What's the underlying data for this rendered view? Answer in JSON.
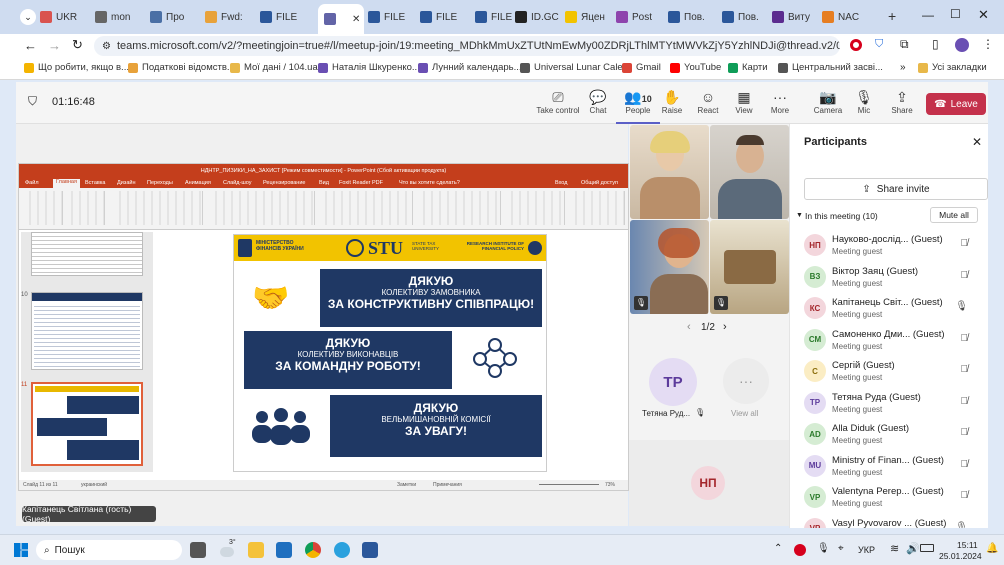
{
  "browser": {
    "tabs": [
      "UKR",
      "mon",
      "Про",
      "Fwd:",
      "FILE",
      "",
      "FILE",
      "FILE",
      "FILE",
      "ID.GC",
      "Яцен",
      "Post",
      "Пов.",
      "Пов.",
      "Виту",
      "NAC"
    ],
    "url": "teams.microsoft.com/v2/?meetingjoin=true#/l/meetup-join/19:meeting_MDhkMmUxZTUtNmEwMy00ZDRjLThlMTYtMWVkZjY5YzhlNDJi@thread.v2/0?context=...",
    "bookmarks": [
      "Що робити, якщо в...",
      "Податкові відомств...",
      "Мої дані / 104.ua",
      "Наталія Шкуренко...",
      "Лунний календарь...",
      "Universal Lunar Cale...",
      "Gmail",
      "YouTube",
      "Карти",
      "Центральний засві..."
    ],
    "all_bookmarks": "Усі закладки"
  },
  "teams": {
    "timer": "01:16:48",
    "toolbar": [
      {
        "label": "Take control",
        "icon": "take-control-icon"
      },
      {
        "label": "Chat",
        "icon": "chat-icon"
      },
      {
        "label": "People",
        "icon": "people-icon",
        "count": "10"
      },
      {
        "label": "Raise",
        "icon": "raise-hand-icon"
      },
      {
        "label": "React",
        "icon": "react-icon"
      },
      {
        "label": "View",
        "icon": "view-icon"
      },
      {
        "label": "More",
        "icon": "more-icon"
      },
      {
        "label": "Camera",
        "icon": "camera-icon"
      },
      {
        "label": "Mic",
        "icon": "mic-icon"
      },
      {
        "label": "Share",
        "icon": "share-icon"
      }
    ],
    "leave": "Leave",
    "pager": "1/2",
    "tiles": [
      {
        "initials": "ТР",
        "name": "Тетяна Руд..."
      },
      {
        "initials": "",
        "name": "View all"
      }
    ],
    "self_tile": "НП",
    "caption": "Капітанець Світлана (гость) (Guest)",
    "participants": {
      "title": "Participants",
      "share_invite": "Share invite",
      "in_meeting": "In this meeting (10)",
      "mute_all": "Mute all",
      "list": [
        {
          "initials": "НП",
          "name": "Науково-дослід... (Guest)",
          "role": "Meeting guest",
          "color": "#f3d6dc",
          "fg": "#a4262c",
          "muted": true
        },
        {
          "initials": "ВЗ",
          "name": "Віктор Заяц (Guest)",
          "role": "Meeting guest",
          "color": "#d5ecd3",
          "fg": "#2b7a2b",
          "muted": true
        },
        {
          "initials": "КС",
          "name": "Капітанець Світ... (Guest)",
          "role": "Meeting guest",
          "color": "#f3d6dc",
          "fg": "#a4262c",
          "muted": false
        },
        {
          "initials": "СМ",
          "name": "Самоненко Дми... (Guest)",
          "role": "Meeting guest",
          "color": "#d5ecd3",
          "fg": "#2b7a2b",
          "muted": true
        },
        {
          "initials": "С",
          "name": "Сергій (Guest)",
          "role": "Meeting guest",
          "color": "#fbedc4",
          "fg": "#8a6d0b",
          "muted": true
        },
        {
          "initials": "ТР",
          "name": "Тетяна Руда (Guest)",
          "role": "Meeting guest",
          "color": "#e4dcf3",
          "fg": "#5c3b9b",
          "muted": true
        },
        {
          "initials": "AD",
          "name": "Alla Diduk (Guest)",
          "role": "Meeting guest",
          "color": "#d5ecd3",
          "fg": "#2b7a2b",
          "muted": true
        },
        {
          "initials": "MU",
          "name": "Ministry of Finan... (Guest)",
          "role": "Meeting guest",
          "color": "#e4dcf3",
          "fg": "#5c3b9b",
          "muted": true
        },
        {
          "initials": "VP",
          "name": "Valentyna Perep... (Guest)",
          "role": "Meeting guest",
          "color": "#d5ecd3",
          "fg": "#2b7a2b",
          "muted": true
        },
        {
          "initials": "VP",
          "name": "Vasyl Pyvovarov ... (Guest)",
          "role": "",
          "color": "#f3d6dc",
          "fg": "#a4262c",
          "muted": false
        }
      ]
    }
  },
  "ppt": {
    "title": "НДНТР_ПИЗИКИ_НА_ЗАХИСТ [Режим совместимости] - PowerPoint (Сбой активации продукта)",
    "menu": [
      "Файл",
      "Главная",
      "Вставка",
      "Дизайн",
      "Переходы",
      "Анимация",
      "Слайд-шоу",
      "Рецензирование",
      "Вид",
      "Foxit Reader PDF",
      "Что вы хотите сделать?",
      "Вход",
      "Общий доступ"
    ],
    "slide_nums": [
      "10",
      "11"
    ],
    "slide": {
      "header_left": "МІНІСТЕРСТВО ФІНАНСІВ УКРАЇНИ",
      "logo": "STU",
      "logo_sub": "STATE TAX UNIVERSITY",
      "header_right": "RESEARCH INSTITUTE OF FINANCIAL POLICY",
      "blocks": [
        {
          "l1": "ДЯКУЮ",
          "l2": "КОЛЕКТИВУ ЗАМОВНИКА",
          "l3": "ЗА КОНСТРУКТИВНУ СПІВПРАЦЮ!"
        },
        {
          "l1": "ДЯКУЮ",
          "l2": "КОЛЕКТИВУ ВИКОНАВЦІВ",
          "l3": "ЗА КОМАНДНУ РОБОТУ!"
        },
        {
          "l1": "ДЯКУЮ",
          "l2": "ВЕЛЬМИШАНОВНІЙ КОМІСІЇ",
          "l3": "ЗА УВАГУ!"
        }
      ]
    },
    "status_left": "Слайд 11 из 11",
    "status_lang": "украинский",
    "status_notes": "Заметки",
    "status_comments": "Примечания",
    "zoom": "73%"
  },
  "taskbar": {
    "search": "Пошук",
    "lang": "УКР",
    "time": "15:11",
    "date": "25.01.2024",
    "temp": "3°"
  }
}
